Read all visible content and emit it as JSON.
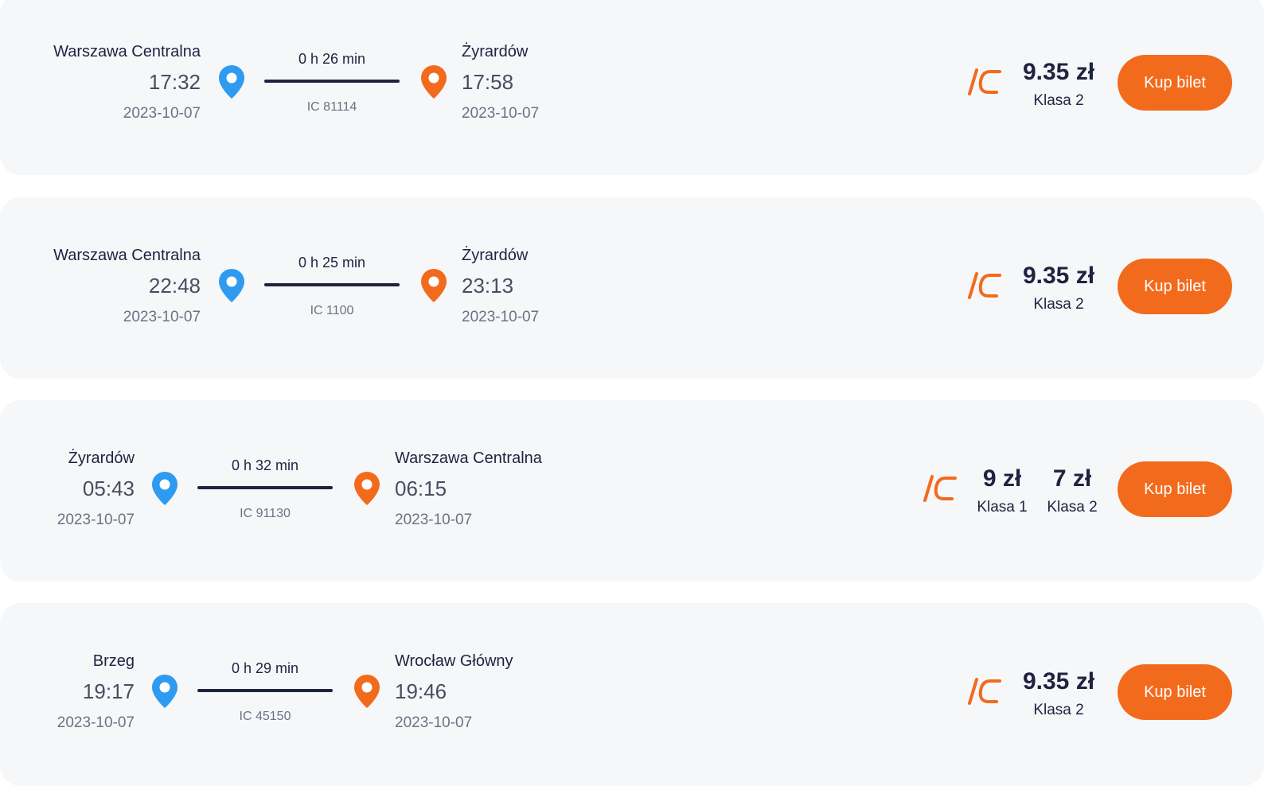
{
  "colors": {
    "accent": "#f26b1d",
    "pin_departure": "#2e9bf0",
    "pin_arrival": "#f26b1d",
    "text": "#1f2340"
  },
  "icons": {
    "departure": "map-pin-icon-blue",
    "arrival": "map-pin-icon-orange",
    "carrier": "ic-logo"
  },
  "connections": [
    {
      "departure": {
        "station": "Warszawa Centralna",
        "time": "17:32",
        "date": "2023-10-07"
      },
      "arrival": {
        "station": "Żyrardów",
        "time": "17:58",
        "date": "2023-10-07"
      },
      "duration": "0 h 26 min",
      "train": "IC 81114",
      "prices": [
        {
          "price": "9.35 zł",
          "class": "Klasa 2"
        }
      ],
      "buy_label": "Kup bilet"
    },
    {
      "departure": {
        "station": "Warszawa Centralna",
        "time": "22:48",
        "date": "2023-10-07"
      },
      "arrival": {
        "station": "Żyrardów",
        "time": "23:13",
        "date": "2023-10-07"
      },
      "duration": "0 h 25 min",
      "train": "IC 1100",
      "prices": [
        {
          "price": "9.35 zł",
          "class": "Klasa 2"
        }
      ],
      "buy_label": "Kup bilet"
    },
    {
      "departure": {
        "station": "Żyrardów",
        "time": "05:43",
        "date": "2023-10-07"
      },
      "arrival": {
        "station": "Warszawa Centralna",
        "time": "06:15",
        "date": "2023-10-07"
      },
      "duration": "0 h 32 min",
      "train": "IC 91130",
      "prices": [
        {
          "price": "9 zł",
          "class": "Klasa 1"
        },
        {
          "price": "7 zł",
          "class": "Klasa 2"
        }
      ],
      "buy_label": "Kup bilet"
    },
    {
      "departure": {
        "station": "Brzeg",
        "time": "19:17",
        "date": "2023-10-07"
      },
      "arrival": {
        "station": "Wrocław Główny",
        "time": "19:46",
        "date": "2023-10-07"
      },
      "duration": "0 h 29 min",
      "train": "IC 45150",
      "prices": [
        {
          "price": "9.35 zł",
          "class": "Klasa 2"
        }
      ],
      "buy_label": "Kup bilet"
    }
  ]
}
